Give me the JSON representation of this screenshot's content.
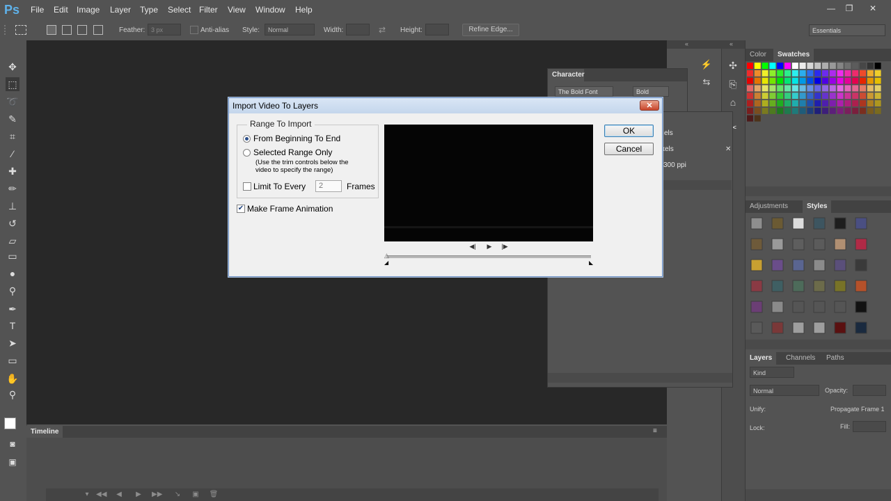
{
  "app": {
    "logo": "Ps",
    "menu": [
      "File",
      "Edit",
      "Image",
      "Layer",
      "Type",
      "Select",
      "Filter",
      "View",
      "Window",
      "Help"
    ],
    "window_controls": {
      "minimize": "—",
      "restore": "❐",
      "close": "✕"
    }
  },
  "options_bar": {
    "feather_label": "Feather:",
    "feather_value": "3 px",
    "antialias_label": "Anti-alias",
    "style_label": "Style:",
    "style_value": "Normal",
    "width_label": "Width:",
    "height_label": "Height:",
    "refine_edge": "Refine Edge...",
    "workspace": "Essentials"
  },
  "character_panel": {
    "tab": "Character",
    "font_family": "The Bold Font",
    "font_style": "Bold"
  },
  "info_panel": {
    "line1": "els",
    "line2": "xels",
    "line3": "300 ppi"
  },
  "color_panel": {
    "tabs": [
      "Color",
      "Swatches"
    ],
    "active_tab": "Swatches"
  },
  "styles_panel": {
    "tabs": [
      "Adjustments",
      "Styles"
    ],
    "active_tab": "Styles"
  },
  "layers_panel": {
    "tabs": [
      "Layers",
      "Channels",
      "Paths"
    ],
    "active_tab": "Layers",
    "kind_label": "Kind",
    "blend_mode": "Normal",
    "opacity_label": "Opacity:",
    "unify_label": "Unify:",
    "propagate_label": "Propagate Frame 1",
    "lock_label": "Lock:",
    "fill_label": "Fill:"
  },
  "timeline": {
    "tab": "Timeline"
  },
  "dialog": {
    "title": "Import Video To Layers",
    "close_glyph": "✕",
    "range_group": "Range To Import",
    "option_beginning": "From Beginning To End",
    "option_selected": "Selected Range Only",
    "selected_hint_line1": "(Use the trim controls below the",
    "selected_hint_line2": "video to specify the range)",
    "limit_label": "Limit To Every",
    "limit_value": "2",
    "frames_label": "Frames",
    "make_animation_label": "Make Frame Animation",
    "ok_label": "OK",
    "cancel_label": "Cancel",
    "range_selection": "beginning",
    "limit_checked": false,
    "make_animation_checked": true
  }
}
